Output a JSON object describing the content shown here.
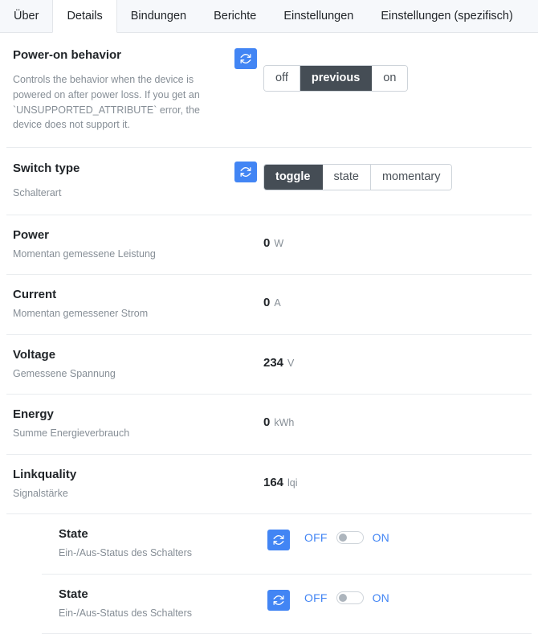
{
  "tabs": [
    {
      "label": "Über",
      "active": false
    },
    {
      "label": "Details",
      "active": true
    },
    {
      "label": "Bindungen",
      "active": false
    },
    {
      "label": "Berichte",
      "active": false
    },
    {
      "label": "Einstellungen",
      "active": false
    },
    {
      "label": "Einstellungen (spezifisch)",
      "active": false
    }
  ],
  "colors": {
    "accent_blue": "#4285f4",
    "selected_dark": "#454d55",
    "muted_text": "#868e96",
    "divider": "#e9ecef"
  },
  "icons": {
    "refresh": "refresh-icon"
  },
  "rows": {
    "power_on_behavior": {
      "label": "Power-on behavior",
      "description": "Controls the behavior when the device is powered on after power loss. If you get an `UNSUPPORTED_ATTRIBUTE` error, the device does not support it.",
      "options": [
        "off",
        "previous",
        "on"
      ],
      "selected": "previous"
    },
    "switch_type": {
      "label": "Switch type",
      "description": "Schalterart",
      "options": [
        "toggle",
        "state",
        "momentary"
      ],
      "selected": "toggle"
    },
    "power": {
      "label": "Power",
      "description": "Momentan gemessene Leistung",
      "value": "0",
      "unit": "W"
    },
    "current": {
      "label": "Current",
      "description": "Momentan gemessener Strom",
      "value": "0",
      "unit": "A"
    },
    "voltage": {
      "label": "Voltage",
      "description": "Gemessene Spannung",
      "value": "234",
      "unit": "V"
    },
    "energy": {
      "label": "Energy",
      "description": "Summe Energieverbrauch",
      "value": "0",
      "unit": "kWh"
    },
    "linkquality": {
      "label": "Linkquality",
      "description": "Signalstärke",
      "value": "164",
      "unit": "lqi"
    },
    "state_1": {
      "label": "State",
      "description": "Ein-/Aus-Status des Schalters",
      "off_label": "OFF",
      "on_label": "ON",
      "state": "off"
    },
    "state_2": {
      "label": "State",
      "description": "Ein-/Aus-Status des Schalters",
      "off_label": "OFF",
      "on_label": "ON",
      "state": "off"
    }
  }
}
